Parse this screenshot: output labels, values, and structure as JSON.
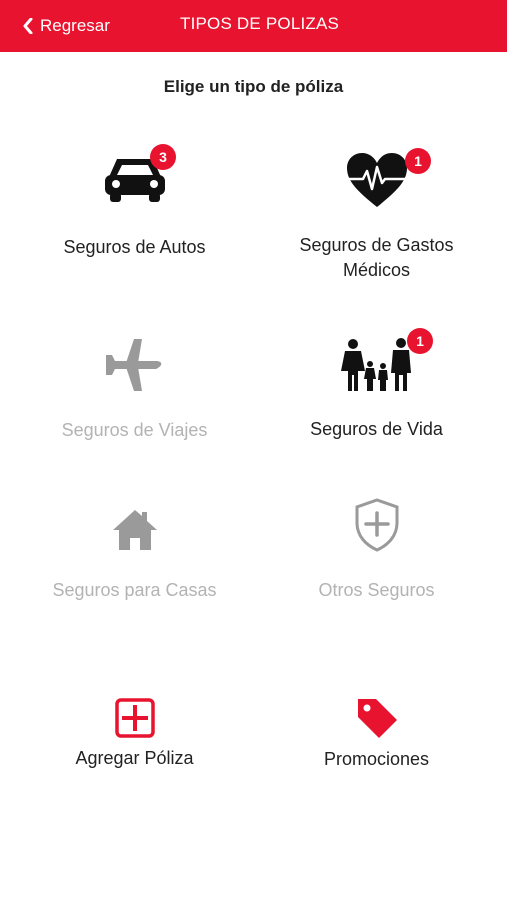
{
  "header": {
    "back_label": "Regresar",
    "title": "TIPOS DE POLIZAS",
    "background": "#e8132f"
  },
  "subtitle": "Elige un tipo de póliza",
  "tiles": [
    {
      "label": "Seguros de Autos",
      "icon": "car-icon",
      "badge": "3",
      "enabled": true
    },
    {
      "label": "Seguros de Gastos Médicos",
      "icon": "heart-pulse-icon",
      "badge": "1",
      "enabled": true
    },
    {
      "label": "Seguros de Viajes",
      "icon": "airplane-icon",
      "badge": null,
      "enabled": false
    },
    {
      "label": "Seguros de Vida",
      "icon": "family-icon",
      "badge": "1",
      "enabled": true
    },
    {
      "label": "Seguros para Casas",
      "icon": "house-icon",
      "badge": null,
      "enabled": false
    },
    {
      "label": "Otros Seguros",
      "icon": "shield-plus-icon",
      "badge": null,
      "enabled": false
    }
  ],
  "actions": [
    {
      "label": "Agregar Póliza",
      "icon": "add-square-icon"
    },
    {
      "label": "Promociones",
      "icon": "tag-icon"
    }
  ],
  "colors": {
    "accent": "#e8132f",
    "text": "#222222",
    "muted": "#b3b3b3"
  }
}
